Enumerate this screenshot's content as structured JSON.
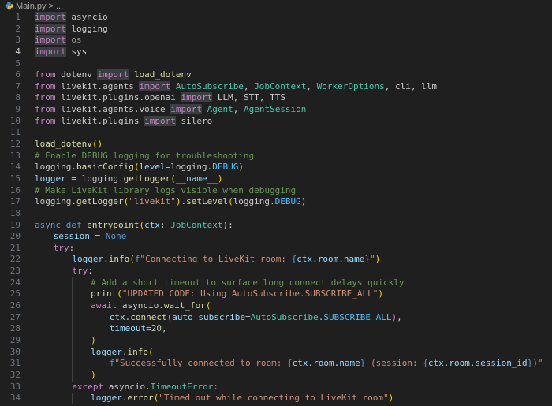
{
  "breadcrumb": {
    "file": "Main.py",
    "separator": ">",
    "ellipsis": "..."
  },
  "current_line": 4,
  "lines": [
    {
      "n": "1",
      "indent": 0,
      "tokens": [
        [
          "kwh",
          "import"
        ],
        [
          "",
          ""
        ],
        [
          "mod",
          " asyncio"
        ]
      ]
    },
    {
      "n": "2",
      "indent": 0,
      "tokens": [
        [
          "kwh",
          "import"
        ],
        [
          "mod",
          " logging"
        ]
      ]
    },
    {
      "n": "3",
      "indent": 0,
      "tokens": [
        [
          "kwh",
          "import"
        ],
        [
          "mod-dim",
          " os"
        ]
      ]
    },
    {
      "n": "4",
      "indent": 0,
      "tokens": [
        [
          "kwh",
          "import"
        ],
        [
          "mod",
          " sys"
        ]
      ],
      "cursor": true
    },
    {
      "n": "5",
      "indent": 0,
      "tokens": []
    },
    {
      "n": "6",
      "indent": 0,
      "tokens": [
        [
          "kw",
          "from"
        ],
        [
          "mod",
          " dotenv "
        ],
        [
          "kwh",
          "import"
        ],
        [
          "fn",
          " load_dotenv"
        ]
      ]
    },
    {
      "n": "7",
      "indent": 0,
      "tokens": [
        [
          "kw",
          "from"
        ],
        [
          "mod",
          " livekit.agents "
        ],
        [
          "kwh",
          "import"
        ],
        [
          "cls",
          " AutoSubscribe"
        ],
        [
          "punc",
          ", "
        ],
        [
          "cls",
          "JobContext"
        ],
        [
          "punc",
          ", "
        ],
        [
          "cls",
          "WorkerOptions"
        ],
        [
          "punc",
          ", "
        ],
        [
          "mod",
          "cli"
        ],
        [
          "punc",
          ", "
        ],
        [
          "mod",
          "llm"
        ]
      ]
    },
    {
      "n": "8",
      "indent": 0,
      "tokens": [
        [
          "kw",
          "from"
        ],
        [
          "mod",
          " livekit.plugins.openai "
        ],
        [
          "kwh",
          "import"
        ],
        [
          "mod",
          " LLM"
        ],
        [
          "punc",
          ", "
        ],
        [
          "mod",
          "STT"
        ],
        [
          "punc",
          ", "
        ],
        [
          "mod",
          "TTS"
        ]
      ]
    },
    {
      "n": "9",
      "indent": 0,
      "tokens": [
        [
          "kw",
          "from"
        ],
        [
          "mod",
          " livekit.agents.voice "
        ],
        [
          "kwh",
          "import"
        ],
        [
          "cls",
          " Agent"
        ],
        [
          "punc",
          ", "
        ],
        [
          "cls",
          "AgentSession"
        ]
      ]
    },
    {
      "n": "10",
      "indent": 0,
      "tokens": [
        [
          "kw",
          "from"
        ],
        [
          "mod",
          " livekit.plugins "
        ],
        [
          "kwh",
          "import"
        ],
        [
          "mod",
          " silero"
        ]
      ]
    },
    {
      "n": "11",
      "indent": 0,
      "tokens": []
    },
    {
      "n": "12",
      "indent": 0,
      "tokens": [
        [
          "fn",
          "load_dotenv"
        ],
        [
          "paren1",
          "()"
        ]
      ]
    },
    {
      "n": "13",
      "indent": 0,
      "tokens": [
        [
          "com",
          "# Enable DEBUG logging for troubleshooting"
        ]
      ]
    },
    {
      "n": "14",
      "indent": 0,
      "tokens": [
        [
          "mod",
          "logging"
        ],
        [
          "punc",
          "."
        ],
        [
          "fn",
          "basicConfig"
        ],
        [
          "paren1",
          "("
        ],
        [
          "var",
          "level"
        ],
        [
          "punc",
          "="
        ],
        [
          "mod",
          "logging"
        ],
        [
          "punc",
          "."
        ],
        [
          "const",
          "DEBUG"
        ],
        [
          "paren1",
          ")"
        ]
      ]
    },
    {
      "n": "15",
      "indent": 0,
      "tokens": [
        [
          "var",
          "logger"
        ],
        [
          "punc",
          " = "
        ],
        [
          "mod",
          "logging"
        ],
        [
          "punc",
          "."
        ],
        [
          "fn",
          "getLogger"
        ],
        [
          "paren1",
          "("
        ],
        [
          "var",
          "__name__"
        ],
        [
          "paren1",
          ")"
        ]
      ]
    },
    {
      "n": "16",
      "indent": 0,
      "tokens": [
        [
          "com",
          "# Make LiveKit library logs visible when debugging"
        ]
      ]
    },
    {
      "n": "17",
      "indent": 0,
      "tokens": [
        [
          "mod",
          "logging"
        ],
        [
          "punc",
          "."
        ],
        [
          "fn",
          "getLogger"
        ],
        [
          "paren1",
          "("
        ],
        [
          "str",
          "\"livekit\""
        ],
        [
          "paren1",
          ")"
        ],
        [
          "punc",
          "."
        ],
        [
          "fn",
          "setLevel"
        ],
        [
          "paren1",
          "("
        ],
        [
          "mod",
          "logging"
        ],
        [
          "punc",
          "."
        ],
        [
          "const",
          "DEBUG"
        ],
        [
          "paren1",
          ")"
        ]
      ]
    },
    {
      "n": "18",
      "indent": 0,
      "tokens": []
    },
    {
      "n": "19",
      "indent": 0,
      "tokens": [
        [
          "def",
          "async"
        ],
        [
          "def",
          " def"
        ],
        [
          "fn",
          " entrypoint"
        ],
        [
          "paren1",
          "("
        ],
        [
          "var",
          "ctx"
        ],
        [
          "punc",
          ": "
        ],
        [
          "cls",
          "JobContext"
        ],
        [
          "paren1",
          ")"
        ],
        [
          "punc",
          ":"
        ]
      ]
    },
    {
      "n": "20",
      "indent": 1,
      "tokens": [
        [
          "var",
          "session"
        ],
        [
          "punc",
          " = "
        ],
        [
          "def",
          "None"
        ]
      ]
    },
    {
      "n": "21",
      "indent": 1,
      "tokens": [
        [
          "kw",
          "try"
        ],
        [
          "punc",
          ":"
        ]
      ]
    },
    {
      "n": "22",
      "indent": 2,
      "tokens": [
        [
          "var",
          "logger"
        ],
        [
          "punc",
          "."
        ],
        [
          "fn",
          "info"
        ],
        [
          "paren1",
          "("
        ],
        [
          "fmt",
          "f"
        ],
        [
          "str",
          "\"Connecting to LiveKit room: "
        ],
        [
          "brace",
          "{"
        ],
        [
          "var",
          "ctx"
        ],
        [
          "punc",
          "."
        ],
        [
          "var",
          "room"
        ],
        [
          "punc",
          "."
        ],
        [
          "var",
          "name"
        ],
        [
          "brace",
          "}"
        ],
        [
          "str",
          "\""
        ],
        [
          "paren1",
          ")"
        ]
      ]
    },
    {
      "n": "23",
      "indent": 2,
      "tokens": [
        [
          "kw",
          "try"
        ],
        [
          "punc",
          ":"
        ]
      ]
    },
    {
      "n": "24",
      "indent": 3,
      "tokens": [
        [
          "com",
          "# Add a short timeout to surface long connect delays quickly"
        ]
      ]
    },
    {
      "n": "25",
      "indent": 3,
      "tokens": [
        [
          "fn",
          "print"
        ],
        [
          "paren1",
          "("
        ],
        [
          "str",
          "\"UPDATED CODE: Using AutoSubscribe.SUBSCRIBE_ALL\""
        ],
        [
          "paren1",
          ")"
        ]
      ]
    },
    {
      "n": "26",
      "indent": 3,
      "tokens": [
        [
          "kw",
          "await"
        ],
        [
          "mod",
          " asyncio"
        ],
        [
          "punc",
          "."
        ],
        [
          "fn",
          "wait_for"
        ],
        [
          "paren1",
          "("
        ]
      ]
    },
    {
      "n": "27",
      "indent": 4,
      "tokens": [
        [
          "var",
          "ctx"
        ],
        [
          "punc",
          "."
        ],
        [
          "fn",
          "connect"
        ],
        [
          "paren2",
          "("
        ],
        [
          "var",
          "auto_subscribe"
        ],
        [
          "punc",
          "="
        ],
        [
          "cls",
          "AutoSubscribe"
        ],
        [
          "punc",
          "."
        ],
        [
          "const",
          "SUBSCRIBE_ALL"
        ],
        [
          "paren2",
          ")"
        ],
        [
          "punc",
          ","
        ]
      ]
    },
    {
      "n": "28",
      "indent": 4,
      "tokens": [
        [
          "var",
          "timeout"
        ],
        [
          "punc",
          "="
        ],
        [
          "num",
          "20"
        ],
        [
          "punc",
          ","
        ]
      ]
    },
    {
      "n": "29",
      "indent": 3,
      "tokens": [
        [
          "paren1",
          ")"
        ]
      ]
    },
    {
      "n": "30",
      "indent": 3,
      "tokens": [
        [
          "var",
          "logger"
        ],
        [
          "punc",
          "."
        ],
        [
          "fn",
          "info"
        ],
        [
          "paren1",
          "("
        ]
      ]
    },
    {
      "n": "31",
      "indent": 4,
      "tokens": [
        [
          "fmt",
          "f"
        ],
        [
          "str",
          "\"Successfully connected to room: "
        ],
        [
          "brace",
          "{"
        ],
        [
          "var",
          "ctx"
        ],
        [
          "punc",
          "."
        ],
        [
          "var",
          "room"
        ],
        [
          "punc",
          "."
        ],
        [
          "var",
          "name"
        ],
        [
          "brace",
          "}"
        ],
        [
          "str",
          " (session: "
        ],
        [
          "brace",
          "{"
        ],
        [
          "var",
          "ctx"
        ],
        [
          "punc",
          "."
        ],
        [
          "var",
          "room"
        ],
        [
          "punc",
          "."
        ],
        [
          "var",
          "session_id"
        ],
        [
          "brace",
          "}"
        ],
        [
          "str",
          ")\""
        ]
      ]
    },
    {
      "n": "32",
      "indent": 3,
      "tokens": [
        [
          "paren1",
          ")"
        ]
      ]
    },
    {
      "n": "33",
      "indent": 2,
      "tokens": [
        [
          "kw",
          "except"
        ],
        [
          "mod",
          " asyncio"
        ],
        [
          "punc",
          "."
        ],
        [
          "cls",
          "TimeoutError"
        ],
        [
          "punc",
          ":"
        ]
      ]
    },
    {
      "n": "34",
      "indent": 3,
      "tokens": [
        [
          "var",
          "logger"
        ],
        [
          "punc",
          "."
        ],
        [
          "fn",
          "error"
        ],
        [
          "paren1",
          "("
        ],
        [
          "str",
          "\"Timed out while connecting to LiveKit room\""
        ],
        [
          "paren1",
          ")"
        ]
      ]
    }
  ]
}
